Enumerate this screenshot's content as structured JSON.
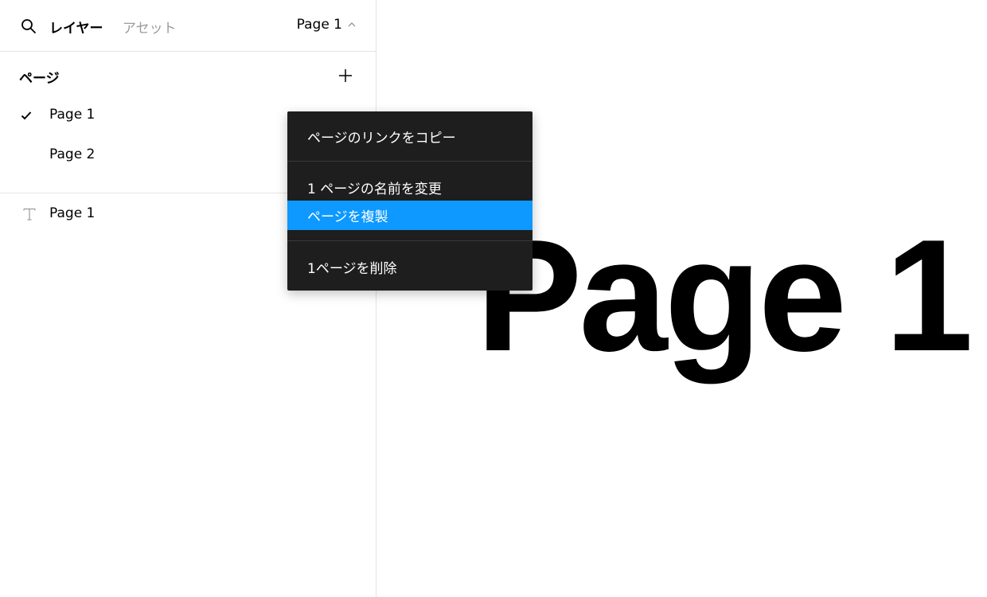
{
  "tabs": {
    "layers_label": "レイヤー",
    "assets_label": "アセット",
    "current_page": "Page 1"
  },
  "pages": {
    "header": "ページ",
    "items": [
      {
        "label": "Page 1",
        "selected": true
      },
      {
        "label": "Page 2",
        "selected": false
      }
    ]
  },
  "layers": [
    {
      "label": "Page 1",
      "icon": "text-icon"
    }
  ],
  "canvas": {
    "text": "Page 1"
  },
  "context_menu": {
    "items": [
      {
        "label": "ページのリンクをコピー"
      },
      {
        "label": "1 ページの名前を変更"
      },
      {
        "label": "ページを複製",
        "highlighted": true
      },
      {
        "label": "1ページを削除"
      }
    ]
  },
  "colors": {
    "accent": "#18a0fb",
    "menu_bg": "#1e1e1e",
    "menu_highlight": "#0d99ff"
  }
}
